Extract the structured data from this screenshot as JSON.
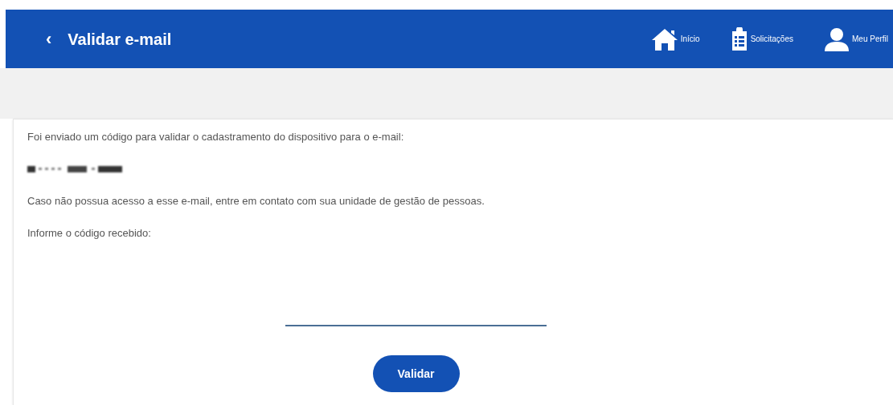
{
  "header": {
    "back": "‹",
    "title": "Validar e-mail",
    "nav": [
      {
        "kind": "home",
        "label": "Início"
      },
      {
        "kind": "clipboard",
        "label": "Solicitações"
      },
      {
        "kind": "user",
        "label": "Meu Perfil"
      }
    ]
  },
  "message": "Foi enviado um código para validar o cadastramento do dispositivo para o e-mail:",
  "note": "Caso não possua acesso a esse e-mail, entre em contato com sua unidade de gestão de pessoas.",
  "code_label": "Informe o código recebido:",
  "button": "Validar"
}
